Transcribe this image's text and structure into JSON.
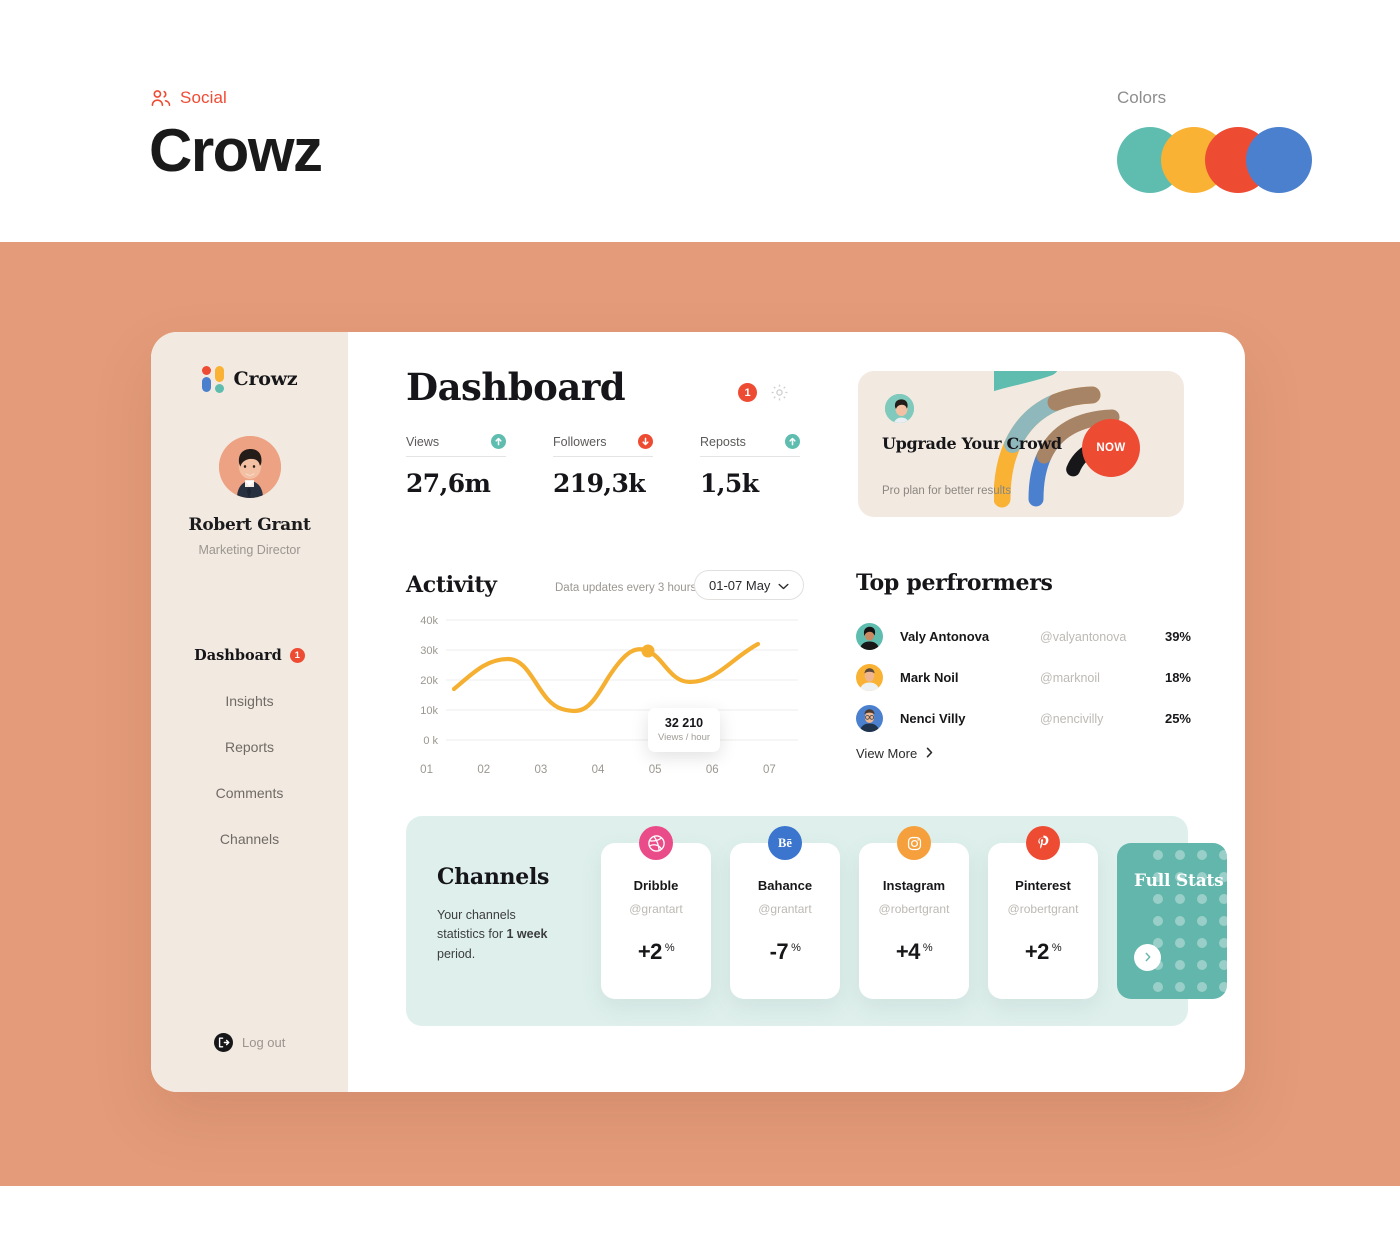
{
  "branding": {
    "social_icon": "people-icon",
    "social_label": "Social",
    "title": "Crowz",
    "colors_label": "Colors",
    "swatches": [
      "#5FBDB0",
      "#F9B233",
      "#EE4B33",
      "#4A80CE"
    ]
  },
  "sidebar": {
    "logo_text": "Crowz",
    "logo_colors": {
      "red": "#EE4B33",
      "yellow": "#F9B233",
      "blue": "#4A80CE",
      "teal": "#5FBDB0"
    },
    "profile": {
      "name": "Robert Grant",
      "role": "Marketing Director",
      "avatar": "user-avatar"
    },
    "nav": [
      {
        "label": "Dashboard",
        "active": true,
        "badge": "1"
      },
      {
        "label": "Insights",
        "active": false,
        "badge": ""
      },
      {
        "label": "Reports",
        "active": false,
        "badge": ""
      },
      {
        "label": "Comments",
        "active": false,
        "badge": ""
      },
      {
        "label": "Channels",
        "active": false,
        "badge": ""
      }
    ],
    "logout_label": "Log out",
    "logout_icon": "logout-icon"
  },
  "header": {
    "title": "Dashboard",
    "alert_count": "1",
    "settings_icon": "gear-icon"
  },
  "stats": [
    {
      "label": "Views",
      "value": "27,6m",
      "trend": "up",
      "trend_color": "#5FBDB0"
    },
    {
      "label": "Followers",
      "value": "219,3k",
      "trend": "down",
      "trend_color": "#EE4B33"
    },
    {
      "label": "Reposts",
      "value": "1,5k",
      "trend": "up",
      "trend_color": "#5FBDB0"
    }
  ],
  "upgrade": {
    "title": "Upgrade Your Crowd",
    "subtitle": "Pro plan for better results",
    "button_label": "NOW",
    "button_color": "#EE4B33",
    "arc_colors": [
      "#F9B233",
      "#8FB8BC",
      "#4A80CE",
      "#A78466",
      "#17171A"
    ]
  },
  "activity": {
    "title": "Activity",
    "note": "Data updates every 3 hours",
    "date_range": "01-07 May",
    "tooltip_value": "32 210",
    "tooltip_label": "Views / hour",
    "line_color": "#F5AF31"
  },
  "chart_data": {
    "type": "line",
    "title": "Activity",
    "x": [
      "01",
      "02",
      "03",
      "04",
      "05",
      "06",
      "07"
    ],
    "values": [
      17000,
      27000,
      20000,
      11000,
      30000,
      23000,
      33000
    ],
    "series": [
      {
        "name": "Views / hour",
        "values": [
          17000,
          27000,
          20000,
          11000,
          30000,
          23000,
          33000
        ]
      }
    ],
    "categories": [
      "01",
      "02",
      "03",
      "04",
      "05",
      "06",
      "07"
    ],
    "ytick_labels": [
      "40k",
      "30k",
      "20k",
      "10k",
      "0 k"
    ],
    "ylim": [
      0,
      40000
    ],
    "xlabel": "",
    "ylabel": "",
    "grid": true,
    "legend": "none",
    "annotation": {
      "x": "05",
      "value": "32 210",
      "label": "Views / hour"
    },
    "line_color": "#F5AF31"
  },
  "top_performers": {
    "title": "Top perfrormers",
    "rows": [
      {
        "name": "Valy Antonova",
        "handle": "@valyantonova",
        "pct": "39%",
        "avatar_bg": "#5FBDB0"
      },
      {
        "name": "Mark Noil",
        "handle": "@marknoil",
        "pct": "18%",
        "avatar_bg": "#F9B233"
      },
      {
        "name": "Nenci Villy",
        "handle": "@nencivilly",
        "pct": "25%",
        "avatar_bg": "#4A80CE"
      }
    ],
    "view_more": "View More"
  },
  "channels": {
    "title": "Channels",
    "description_prefix": "Your channels statistics for ",
    "description_bold": "1 week",
    "description_suffix": " period.",
    "cards": [
      {
        "name": "Dribble",
        "handle": "@grantart",
        "delta": "+2",
        "unit": "%",
        "icon": "dribbble-icon",
        "icon_bg": "#EA4C89"
      },
      {
        "name": "Bahance",
        "handle": "@grantart",
        "delta": "-7",
        "unit": "%",
        "icon": "behance-icon",
        "icon_bg": "#3B75CE"
      },
      {
        "name": "Instagram",
        "handle": "@robertgrant",
        "delta": "+4",
        "unit": "%",
        "icon": "instagram-icon",
        "icon_bg": "#F5A03C"
      },
      {
        "name": "Pinterest",
        "handle": "@robertgrant",
        "delta": "+2",
        "unit": "%",
        "icon": "pinterest-icon",
        "icon_bg": "#EE4B33"
      }
    ],
    "full_stats_title": "Full Stats",
    "full_stats_bg": "#63B6AB",
    "full_stats_icon": "chevron-right-icon"
  },
  "theme": {
    "stage_bg": "#E39B79",
    "sidebar_bg": "#F2EAE1",
    "channels_bg": "#DFF0EC"
  }
}
